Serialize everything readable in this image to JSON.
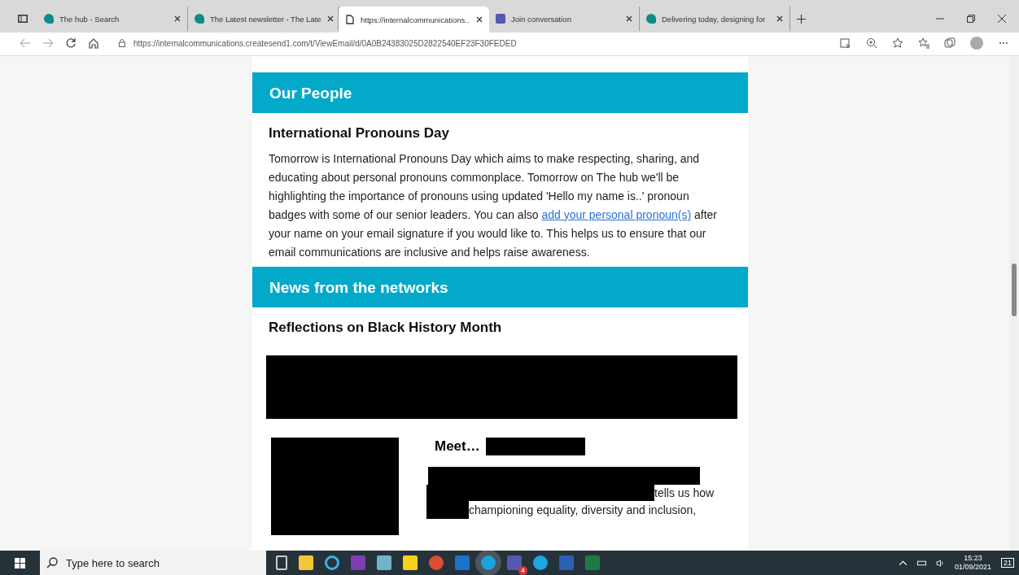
{
  "tabs": [
    {
      "title": "The hub - Search",
      "kind": "hub",
      "selected": false
    },
    {
      "title": "The Latest newsletter - The Late",
      "kind": "hub",
      "selected": false
    },
    {
      "title": "https://internalcommunications..",
      "kind": "page",
      "selected": true
    },
    {
      "title": "Join conversation",
      "kind": "teams",
      "selected": false
    },
    {
      "title": "Delivering today, designing for",
      "kind": "hub",
      "selected": false
    }
  ],
  "address": "https://internalcommunications.createsend1.com/t/ViewEmail/d/0A0B24383025D2822540EF23F30FEDED",
  "sections": [
    {
      "banner": "Our People",
      "heading": "International Pronouns Day",
      "paragraph": {
        "before": "Tomorrow is International Pronouns Day which aims to make respecting, sharing, and educating about personal pronouns commonplace. Tomorrow on The hub we'll be highlighting the importance of pronouns using updated 'Hello my name is..' pronoun badges with some of our senior leaders. You can also ",
        "link": "add your personal pronoun(s)",
        "after": " after your name on your email signature if you would like to. This helps us to ensure that our email communications are inclusive and helps raise awareness."
      }
    },
    {
      "banner": "News from the networks",
      "heading": "Reflections on Black History Month"
    }
  ],
  "feature": {
    "title": "Meet…",
    "line_1": "tells us how",
    "line_2": "championing equality, diversity and inclusion,"
  },
  "taskbar": {
    "search_placeholder": "Type here to search",
    "teams_badge": "4",
    "time": "15:23",
    "date": "01/09/2021",
    "notifications": "21"
  }
}
